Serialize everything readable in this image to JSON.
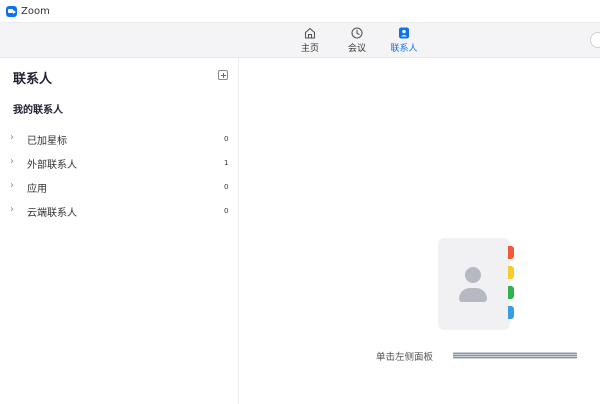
{
  "window": {
    "title": "Zoom"
  },
  "nav": {
    "tabs": [
      {
        "label": "主页",
        "icon": "home-icon"
      },
      {
        "label": "会议",
        "icon": "clock-icon"
      },
      {
        "label": "联系人",
        "icon": "contacts-icon",
        "active": true
      }
    ]
  },
  "sidebar": {
    "header": "联系人",
    "section_title": "我的联系人",
    "groups": [
      {
        "label": "已加星标",
        "count": "0"
      },
      {
        "label": "外部联系人",
        "count": "1"
      },
      {
        "label": "应用",
        "count": "0"
      },
      {
        "label": "云端联系人",
        "count": "0"
      }
    ]
  },
  "main": {
    "empty_hint": "单击左侧面板"
  },
  "colors": {
    "accent": "#0e72ed",
    "tab_red": "#f05a3b",
    "tab_yellow": "#f6cc2d",
    "tab_green": "#2fb34a",
    "tab_blue": "#3a9be8"
  }
}
